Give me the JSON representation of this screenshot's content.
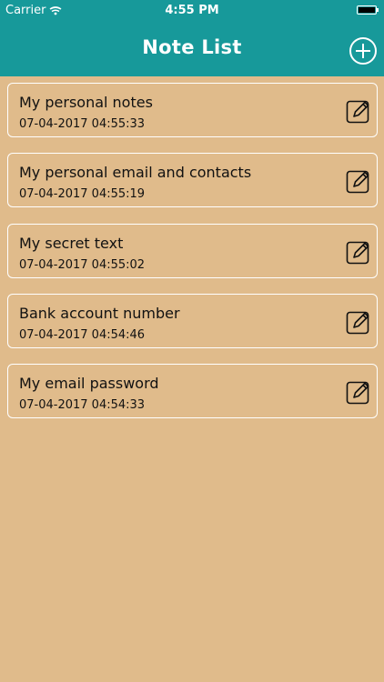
{
  "status_bar": {
    "carrier": "Carrier",
    "time": "4:55 PM"
  },
  "header": {
    "title": "Note List",
    "add_icon": "plus-circle-icon"
  },
  "notes": [
    {
      "title": "My personal notes",
      "date": "07-04-2017 04:55:33",
      "icon": "edit-icon"
    },
    {
      "title": "My personal email and contacts",
      "date": "07-04-2017 04:55:19",
      "icon": "edit-icon"
    },
    {
      "title": "My secret text",
      "date": "07-04-2017 04:55:02",
      "icon": "edit-icon"
    },
    {
      "title": "Bank account number",
      "date": "07-04-2017 04:54:46",
      "icon": "edit-icon"
    },
    {
      "title": "My email password",
      "date": "07-04-2017 04:54:33",
      "icon": "edit-icon"
    }
  ],
  "colors": {
    "header": "#17999a",
    "background": "#e0bb8b",
    "card_border": "#ffffff"
  }
}
